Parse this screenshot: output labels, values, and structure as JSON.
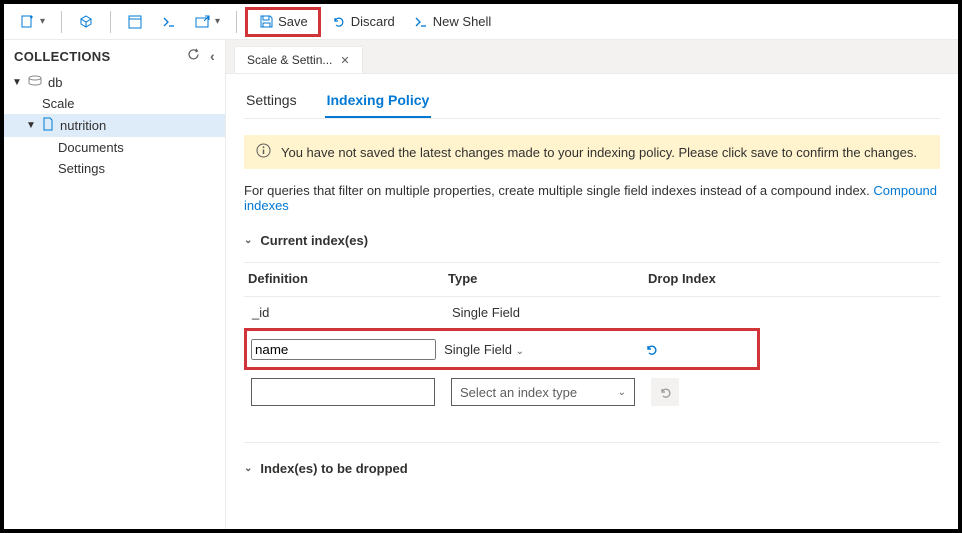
{
  "toolbar": {
    "save_label": "Save",
    "discard_label": "Discard",
    "newshell_label": "New Shell"
  },
  "sidebar": {
    "title": "COLLECTIONS",
    "db_label": "db",
    "scale_label": "Scale",
    "nutrition_label": "nutrition",
    "documents_label": "Documents",
    "settings_label": "Settings"
  },
  "tab": {
    "label": "Scale & Settin..."
  },
  "subtabs": {
    "settings": "Settings",
    "indexing": "Indexing Policy"
  },
  "notice": "You have not saved the latest changes made to your indexing policy. Please click save to confirm the changes.",
  "desc_text": "For queries that filter on multiple properties, create multiple single field indexes instead of a compound index. ",
  "desc_link": "Compound indexes",
  "sections": {
    "current": "Current index(es)",
    "dropped": "Index(es) to be dropped"
  },
  "headers": {
    "definition": "Definition",
    "type": "Type",
    "drop": "Drop Index"
  },
  "rows": {
    "r1_def": "_id",
    "r1_type": "Single Field",
    "r2_def": "name",
    "r2_type": "Single Field",
    "r3_def": "",
    "r3_type": "Select an index type"
  }
}
